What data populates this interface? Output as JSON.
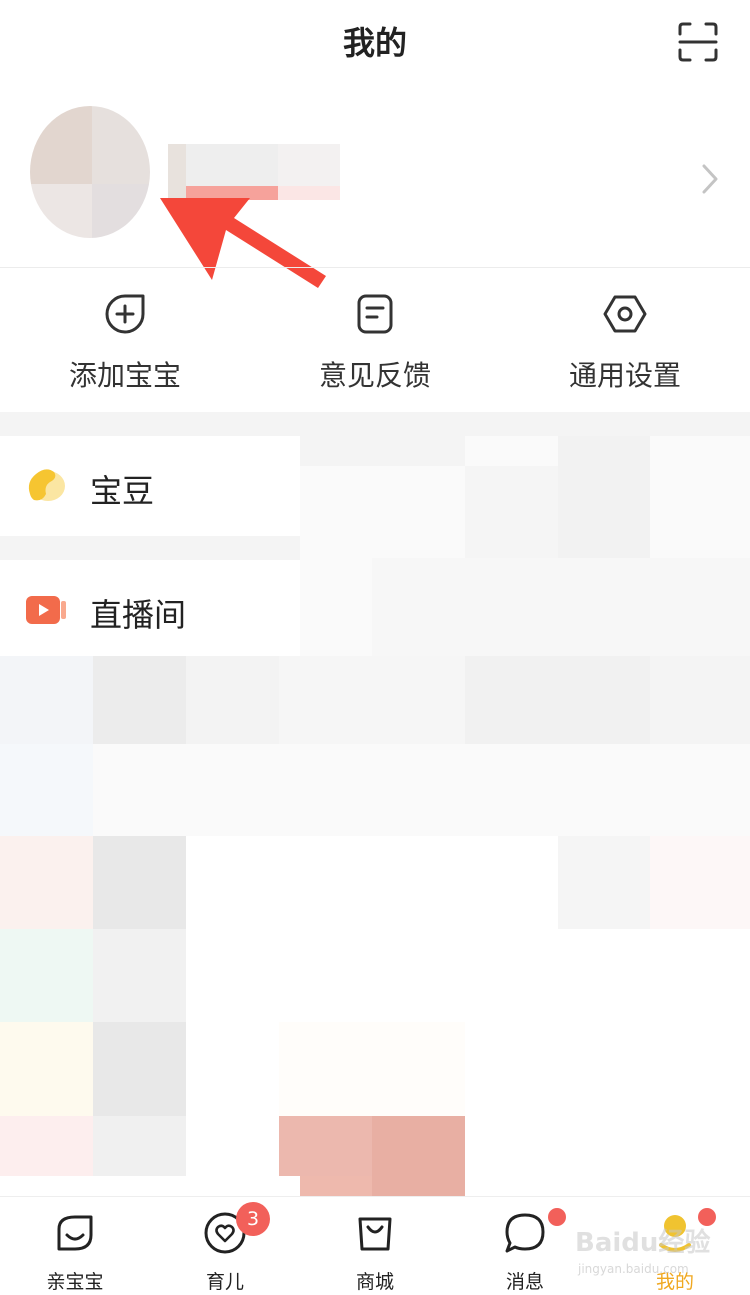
{
  "header": {
    "title": "我的"
  },
  "quick_actions": [
    {
      "label": "添加宝宝"
    },
    {
      "label": "意见反馈"
    },
    {
      "label": "通用设置"
    }
  ],
  "list": {
    "bean": {
      "label": "宝豆"
    },
    "live": {
      "label": "直播间"
    }
  },
  "nav": {
    "tabs": [
      {
        "label": "亲宝宝"
      },
      {
        "label": "育儿",
        "badge": "3"
      },
      {
        "label": "商城"
      },
      {
        "label": "消息"
      },
      {
        "label": "我的"
      }
    ]
  },
  "watermark": "Baidu经验",
  "watermark_sub": "jingyan.baidu.com",
  "colors": {
    "accent_orange": "#f26b4b",
    "nav_active": "#f0c330",
    "badge": "#f2605a",
    "arrow_annotation": "#f4473a"
  }
}
